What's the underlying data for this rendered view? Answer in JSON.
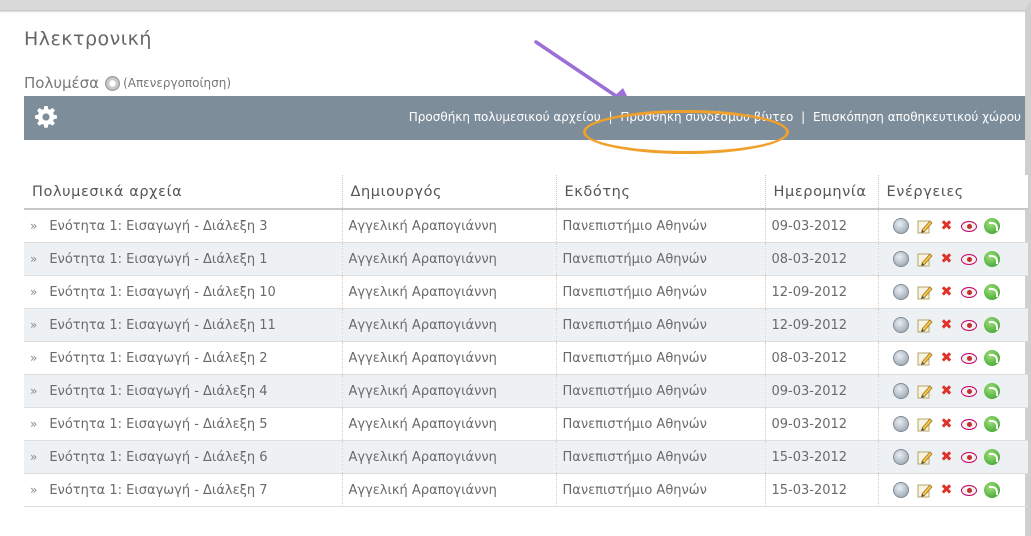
{
  "site": {
    "title": "Ηλεκτρονική"
  },
  "section": {
    "title": "Πολυμέσα",
    "toggle_label": "(Απενεργοποίηση)"
  },
  "toolbar": {
    "add_media_label": "Προσθήκη πολυμεσικού αρχείου",
    "add_video_link_label": "Προσθήκη συνδέσμου βίντεο",
    "storage_overview_label": "Επισκόπηση αποθηκευτικού χώρου",
    "separator": "|"
  },
  "table": {
    "headers": [
      "Πολυμεσικά αρχεία",
      "Δημιουργός",
      "Εκδότης",
      "Ημερομηνία",
      "Ενέργειες"
    ],
    "bullet": "»",
    "rows": [
      {
        "title": "Ενότητα 1: Εισαγωγή - Διάλεξη 3",
        "creator": "Αγγελική Αραπογιάννη",
        "publisher": "Πανεπιστήμιο Αθηνών",
        "date": "09-03-2012"
      },
      {
        "title": "Ενότητα 1: Εισαγωγή - Διάλεξη 1",
        "creator": "Αγγελική Αραπογιάννη",
        "publisher": "Πανεπιστήμιο Αθηνών",
        "date": "08-03-2012"
      },
      {
        "title": "Ενότητα 1: Εισαγωγή - Διάλεξη 10",
        "creator": "Αγγελική Αραπογιάννη",
        "publisher": "Πανεπιστήμιο Αθηνών",
        "date": "12-09-2012"
      },
      {
        "title": "Ενότητα 1: Εισαγωγή - Διάλεξη 11",
        "creator": "Αγγελική Αραπογιάννη",
        "publisher": "Πανεπιστήμιο Αθηνών",
        "date": "12-09-2012"
      },
      {
        "title": "Ενότητα 1: Εισαγωγή - Διάλεξη 2",
        "creator": "Αγγελική Αραπογιάννη",
        "publisher": "Πανεπιστήμιο Αθηνών",
        "date": "08-03-2012"
      },
      {
        "title": "Ενότητα 1: Εισαγωγή - Διάλεξη 4",
        "creator": "Αγγελική Αραπογιάννη",
        "publisher": "Πανεπιστήμιο Αθηνών",
        "date": "09-03-2012"
      },
      {
        "title": "Ενότητα 1: Εισαγωγή - Διάλεξη 5",
        "creator": "Αγγελική Αραπογιάννη",
        "publisher": "Πανεπιστήμιο Αθηνών",
        "date": "09-03-2012"
      },
      {
        "title": "Ενότητα 1: Εισαγωγή - Διάλεξη 6",
        "creator": "Αγγελική Αραπογιάννη",
        "publisher": "Πανεπιστήμιο Αθηνών",
        "date": "15-03-2012"
      },
      {
        "title": "Ενότητα 1: Εισαγωγή - Διάλεξη 7",
        "creator": "Αγγελική Αραπογιάννη",
        "publisher": "Πανεπιστήμιο Αθηνών",
        "date": "15-03-2012"
      }
    ],
    "row_actions": [
      "globe-icon",
      "edit-icon",
      "delete-icon",
      "visibility-icon",
      "refresh-icon"
    ]
  },
  "colors": {
    "toolbar_bg": "#7d8d9a",
    "highlight": "#f0a12b",
    "arrow": "#9b6fd6",
    "delete": "#e0322b"
  }
}
